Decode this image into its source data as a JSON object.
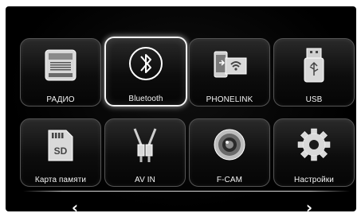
{
  "tiles": [
    {
      "label": "РАДИО",
      "icon": "radio-icon",
      "active": false
    },
    {
      "label": "Bluetooth",
      "icon": "bluetooth-icon",
      "active": true
    },
    {
      "label": "PHONELINK",
      "icon": "phonelink-icon",
      "active": false
    },
    {
      "label": "USB",
      "icon": "usb-icon",
      "active": false
    },
    {
      "label": "Карта памяти",
      "icon": "sd-card-icon",
      "active": false
    },
    {
      "label": "AV IN",
      "icon": "av-in-cable-icon",
      "active": false
    },
    {
      "label": "F-CAM",
      "icon": "camera-lens-icon",
      "active": false
    },
    {
      "label": "Настройки",
      "icon": "gear-icon",
      "active": false
    }
  ],
  "nav": {
    "prev": "‹",
    "next": "›"
  },
  "colors": {
    "background": "#000000",
    "text": "#ffffff",
    "active_border": "#f2f2f2"
  }
}
